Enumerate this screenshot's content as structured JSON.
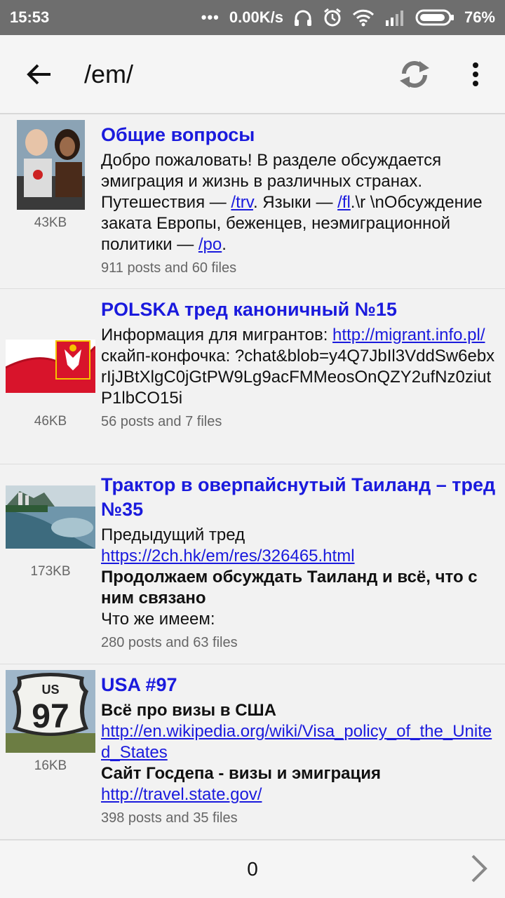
{
  "status": {
    "time": "15:53",
    "network_speed": "0.00K/s",
    "battery": "76%"
  },
  "toolbar": {
    "back_icon": "arrow-back-icon",
    "title": "/em/",
    "refresh_icon": "refresh-icon",
    "more_icon": "more-vert-icon"
  },
  "threads": [
    {
      "title": "Общие вопросы",
      "size": "43KB",
      "line1": "Добро пожаловать! В разделе обсуждается эмиграция и жизнь в различных странах. Путешествия — ",
      "link1": "/trv",
      "line2": ". Языки — ",
      "link2": "/fl",
      "line3": ".\\r \\nОбсуждение заката Европы, беженцев, неэмиграционной политики — ",
      "link3": "/po",
      "line4": ".",
      "stats": "911 posts and 60 files"
    },
    {
      "title": "POLSKA тред каноничный №15",
      "size": "46KB",
      "line1": "Информация для мигрантов: ",
      "link1": "http://migrant.info.pl/",
      "line2": "скайп-конфочка: ?chat&blob=y4Q7JbIl3VddSw6ebxrIjJBtXlgC0jGtPW9Lg9acFMMeosOnQZY2ufNz0ziutP1lbCO15i",
      "stats": "56 posts and 7 files"
    },
    {
      "title": "Трактор в оверпайснутый Таиланд – тред №35",
      "size": "173KB",
      "line1": "Предыдущий тред",
      "link1": "https://2ch.hk/em/res/326465.html",
      "bold1": "Продолжаем обсуждать Таиланд и всё, что с ним связано",
      "line2": "Что же имеем:",
      "stats": "280 posts and 63 files"
    },
    {
      "title": "USA #97",
      "size": "16KB",
      "bold1": "Всё про визы в США",
      "link1": "http://en.wikipedia.org/wiki/Visa_policy_of_the_United_States",
      "bold2": "Сайт Госдепа - визы и эмиграция",
      "link2": "http://travel.state.gov/",
      "stats": "398 posts and 35 files",
      "sign_top": "US",
      "sign_number": "97"
    }
  ],
  "pager": {
    "page": "0",
    "next_icon": "chevron-right-icon"
  }
}
